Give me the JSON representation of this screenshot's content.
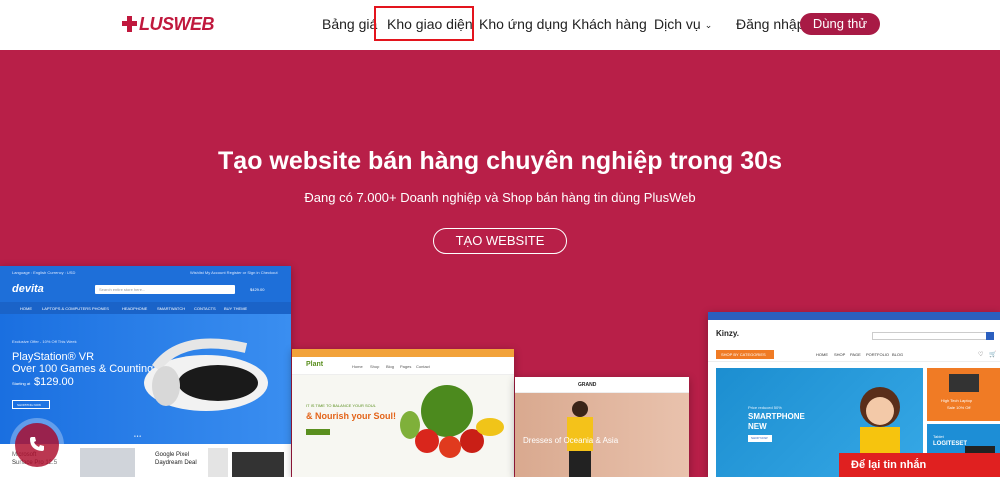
{
  "logo": {
    "text_p": "P",
    "text_lus": "LUS",
    "text_web": "WEB"
  },
  "nav": {
    "items": [
      "Bảng giá",
      "Kho giao diện",
      "Kho ứng dụng",
      "Khách hàng",
      "Dịch vụ"
    ],
    "login": "Đăng nhập",
    "try": "Dùng thử"
  },
  "hero": {
    "title": "Tạo website bán hàng chuyên nghiệp trong 30s",
    "subtitle": "Đang có 7.000+ Doanh nghiệp và Shop bán hàng tin dùng PlusWeb",
    "cta": "TẠO WEBSITE"
  },
  "templates": {
    "t1": {
      "logo": "devita",
      "top_left": "Language : English   Currency : USD",
      "top_right": "Wishlist   My Account   Register or Sign in   Checkout",
      "search": "Search entire store here...",
      "cart": "$429.00",
      "nav": [
        "HOME",
        "LAPTOPS & COMPUTERS",
        "PHONES",
        "HEADPHONE",
        "SMARTWATCH",
        "CONTACTS",
        "BUY THEME"
      ],
      "offer": "Exclusive Offer - 10% Off This Week",
      "headline1": "PlayStation® VR",
      "headline2": "Over 100 Games & Counting",
      "starting": "Starting at",
      "price": "$129.00",
      "shop": "SHOPPING NOW",
      "p1a": "Microsoft",
      "p1b": "Surface Pro 12.5",
      "p2a": "Google Pixel",
      "p2b": "Daydream Deal"
    },
    "t2": {
      "logo": "Plant",
      "tagline": "IT IS TIME TO BALANCE YOUR SOUL",
      "headline": "& Nourish your Soul!",
      "nav": [
        "Home",
        "Shop",
        "Blog",
        "Pages",
        "Contact"
      ]
    },
    "t3": {
      "logo": "GRAND",
      "banner": "Dresses of Oceania & Asia"
    },
    "t4": {
      "logo": "Kinzy.",
      "cats": "SHOP BY CATEGORIES",
      "nav": [
        "HOME",
        "SHOP",
        "PAGE",
        "PORTFOLIO",
        "BLOG"
      ],
      "promo_small": "Price reduced 50%",
      "promo_big1": "SMARTPHONE",
      "promo_big2": "NEW",
      "promo_btn": "SHOP NOW",
      "side1_a": "High Tech Laptop",
      "side1_b": "Sale 10% Off",
      "side2_a": "Tablet",
      "side2_b": "LOGITESET"
    }
  },
  "floating": {
    "message": "Để lại tin nhắn"
  },
  "colors": {
    "brand": "#b81f48",
    "button": "#a81a45",
    "highlight": "#e3141d",
    "message": "#e02020"
  }
}
